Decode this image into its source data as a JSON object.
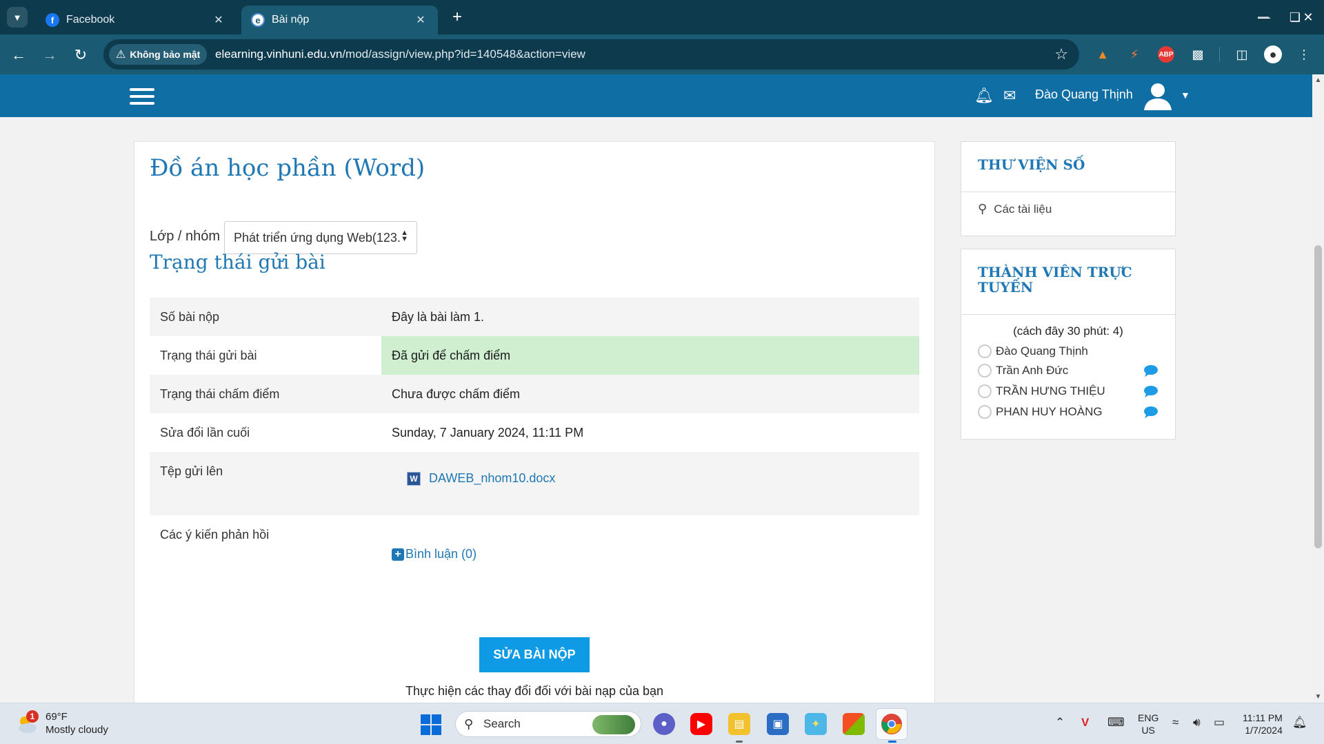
{
  "browser": {
    "tabs": [
      {
        "title": "Facebook",
        "icon": "facebook-icon"
      },
      {
        "title": "Bài nộp",
        "icon": "moodle-icon"
      }
    ],
    "security_label": "Không bảo mật",
    "url_domain": "elearning.vinhuni.edu.vn",
    "url_path": "/mod/assign/view.php?id=140548&action=view",
    "abp_label": "ABP"
  },
  "header": {
    "user_name": "Đào Quang Thịnh",
    "color": "#0f6fa5"
  },
  "main": {
    "page_title": "Đồ án học phần (Word)",
    "group_label": "Lớp / nhóm",
    "group_selected": "Phát triển ứng dụng Web(123.",
    "section_title": "Trạng thái gửi bài",
    "status_rows": [
      {
        "label": "Số bài nộp",
        "value": "Đây là bài làm 1."
      },
      {
        "label": "Trạng thái gửi bài",
        "value": "Đã gửi để chấm điểm"
      },
      {
        "label": "Trạng thái chấm điểm",
        "value": "Chưa được chấm điểm"
      },
      {
        "label": "Sửa đổi lần cuối",
        "value": "Sunday, 7 January 2024, 11:11 PM"
      },
      {
        "label": "Tệp gửi lên",
        "value": "DAWEB_nhom10.docx"
      },
      {
        "label": "Các ý kiến phản hồi",
        "value": "Bình luận (0)"
      }
    ],
    "edit_button": "SỬA BÀI NỘP",
    "edit_note": "Thực hiện các thay đổi đối với bài nạp của bạn",
    "submitted_color": "#cfefd0"
  },
  "sidebar": {
    "library": {
      "title": "THƯ VIỆN SỐ",
      "item": "Các tài liệu"
    },
    "online": {
      "title": "THÀNH VIÊN TRỰC TUYẾN",
      "count_text": "(cách đây 30 phút: 4)",
      "users": [
        {
          "name": "Đào Quang Thịnh",
          "message": false
        },
        {
          "name": "Trần Anh Đức",
          "message": true
        },
        {
          "name": "TRẦN HƯNG THIỆU",
          "message": true
        },
        {
          "name": "PHAN HUY HOÀNG",
          "message": true
        }
      ]
    }
  },
  "taskbar": {
    "weather_temp": "69°F",
    "weather_desc": "Mostly cloudy",
    "weather_badge": "1",
    "search_label": "Search",
    "lang_line1": "ENG",
    "lang_line2": "US",
    "time": "11:11 PM",
    "date": "1/7/2024"
  }
}
